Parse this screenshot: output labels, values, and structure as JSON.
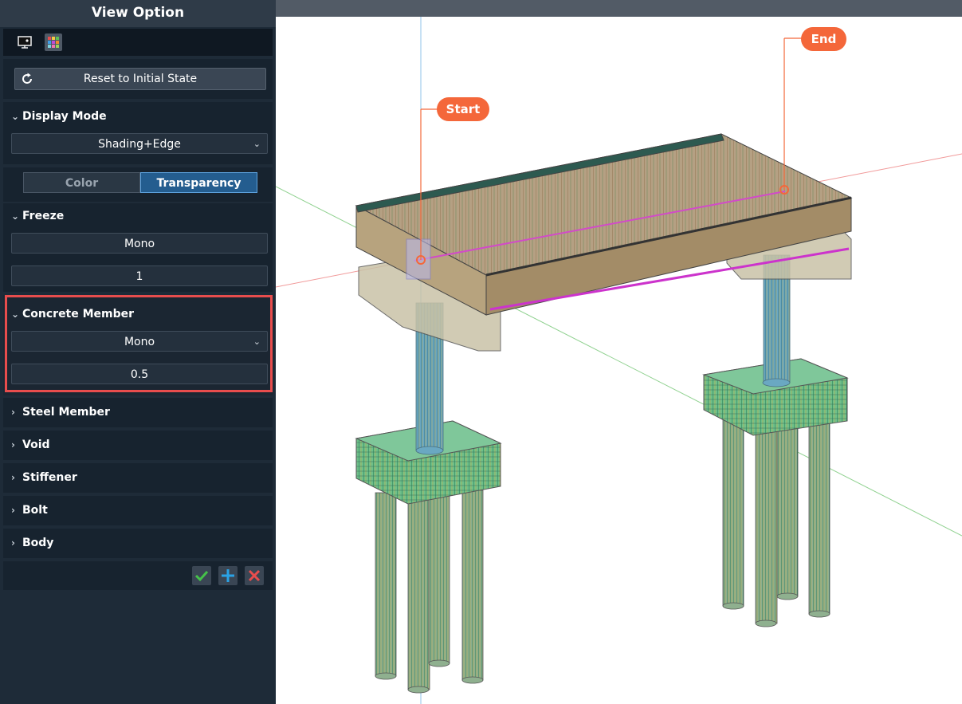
{
  "panel": {
    "title": "View Option",
    "reset_label": "Reset to Initial State",
    "display_mode": {
      "label": "Display Mode",
      "value": "Shading+Edge"
    },
    "mode_toggle": {
      "left": "Color",
      "right": "Transparency",
      "active": "Transparency"
    },
    "freeze": {
      "label": "Freeze",
      "mode": "Mono",
      "value": "1"
    },
    "concrete": {
      "label": "Concrete Member",
      "mode": "Mono",
      "value": "0.5"
    },
    "collapsed": [
      {
        "label": "Steel Member"
      },
      {
        "label": "Void"
      },
      {
        "label": "Stiffener"
      },
      {
        "label": "Bolt"
      },
      {
        "label": "Body"
      }
    ]
  },
  "viewport": {
    "start_label": "Start",
    "end_label": "End"
  },
  "colors": {
    "panel_bg": "#1e2b38",
    "accent": "#245d8f",
    "highlight": "#e84d4d",
    "marker": "#f4673a"
  }
}
